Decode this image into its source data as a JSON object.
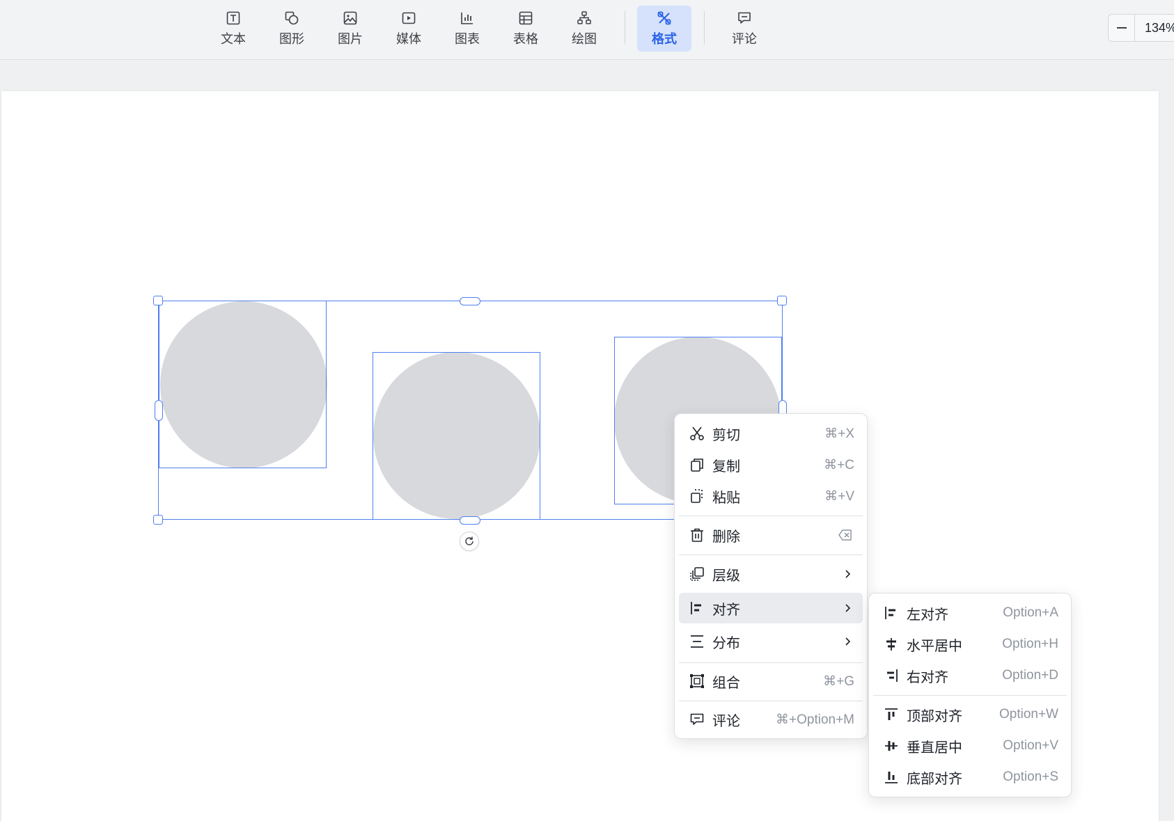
{
  "toolbar": {
    "items": [
      {
        "label": "文本",
        "icon": "text-icon"
      },
      {
        "label": "图形",
        "icon": "shape-icon"
      },
      {
        "label": "图片",
        "icon": "image-icon"
      },
      {
        "label": "媒体",
        "icon": "media-icon"
      },
      {
        "label": "图表",
        "icon": "chart-icon"
      },
      {
        "label": "表格",
        "icon": "table-icon"
      },
      {
        "label": "绘图",
        "icon": "diagram-icon"
      },
      {
        "label": "格式",
        "icon": "format-icon",
        "active": true
      },
      {
        "label": "评论",
        "icon": "comment-icon"
      }
    ],
    "zoom_value": "134%"
  },
  "context_menu": {
    "cut": {
      "label": "剪切",
      "shortcut": "⌘+X",
      "icon": "scissors-icon"
    },
    "copy": {
      "label": "复制",
      "shortcut": "⌘+C",
      "icon": "copy-icon"
    },
    "paste": {
      "label": "粘贴",
      "shortcut": "⌘+V",
      "icon": "paste-icon"
    },
    "delete": {
      "label": "删除",
      "icon": "trash-icon",
      "shortcut_icon": "backspace-icon"
    },
    "layer": {
      "label": "层级",
      "icon": "layer-icon"
    },
    "align": {
      "label": "对齐",
      "icon": "align-left-icon",
      "highlighted": true
    },
    "distribute": {
      "label": "分布",
      "icon": "distribute-icon"
    },
    "group": {
      "label": "组合",
      "shortcut": "⌘+G",
      "icon": "group-icon"
    },
    "comment": {
      "label": "评论",
      "shortcut": "⌘+Option+M",
      "icon": "comment-icon"
    }
  },
  "align_submenu": {
    "left": {
      "label": "左对齐",
      "shortcut": "Option+A"
    },
    "hcenter": {
      "label": "水平居中",
      "shortcut": "Option+H"
    },
    "right": {
      "label": "右对齐",
      "shortcut": "Option+D"
    },
    "top": {
      "label": "顶部对齐",
      "shortcut": "Option+W"
    },
    "vcenter": {
      "label": "垂直居中",
      "shortcut": "Option+V"
    },
    "bottom": {
      "label": "底部对齐",
      "shortcut": "Option+S"
    }
  },
  "colors": {
    "accent": "#2a63e8",
    "selection": "#4e7ff0",
    "shape_fill": "#d8d9dd",
    "active_tab_bg": "#d6e2fb"
  }
}
